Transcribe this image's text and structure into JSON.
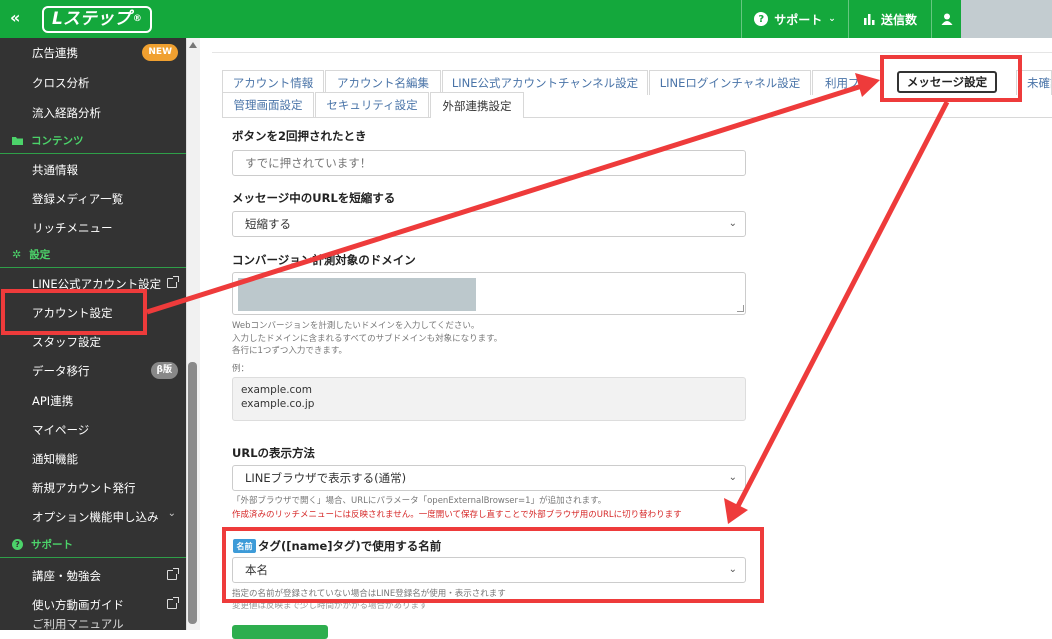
{
  "header": {
    "collapse_label": "«",
    "logo_text": "Lステップ",
    "logo_mark": "®",
    "support_label": "サポート",
    "sent_label": "送信数"
  },
  "sidebar": {
    "items": [
      {
        "label": "広告連携",
        "badge": "NEW"
      },
      {
        "label": "クロス分析"
      },
      {
        "label": "流入経路分析"
      },
      {
        "section": "コンテンツ"
      },
      {
        "label": "共通情報"
      },
      {
        "label": "登録メディア一覧"
      },
      {
        "label": "リッチメニュー"
      },
      {
        "section": "設定"
      },
      {
        "label": "LINE公式アカウント設定"
      },
      {
        "label": "アカウント設定"
      },
      {
        "label": "スタッフ設定"
      },
      {
        "label": "データ移行",
        "badge": "β版"
      },
      {
        "label": "API連携"
      },
      {
        "label": "マイページ"
      },
      {
        "label": "通知機能"
      },
      {
        "label": "新規アカウント発行"
      },
      {
        "label": "オプション機能申し込み"
      },
      {
        "section": "サポート"
      },
      {
        "label": "講座・勉強会"
      },
      {
        "label": "使い方動画ガイド"
      },
      {
        "label": "ご利用マニュアル"
      }
    ]
  },
  "tabs": [
    "アカウント情報",
    "アカウント名編集",
    "LINE公式アカウントチャンネル設定",
    "LINEログインチャネル設定",
    "利用プ",
    "メッセージ設定",
    "未確認ア",
    "管理画面設定",
    "セキュリティ設定",
    "外部連携設定"
  ],
  "form": {
    "double_press_label": "ボタンを2回押されたとき",
    "double_press_placeholder": "すでに押されています！",
    "url_shorten_label": "メッセージ中のURLを短縮する",
    "url_shorten_value": "短縮する",
    "conversion_label": "コンバージョン計測対象のドメイン",
    "conversion_help": [
      "Webコンバージョンを計測したいドメインを入力してください。",
      "入力したドメインに含まれるすべてのサブドメインも対象になります。",
      "各行に1つずつ入力できます。"
    ],
    "example_label": "例：",
    "example_lines": [
      "example.com",
      "example.co.jp"
    ],
    "url_display_label": "URLの表示方法",
    "url_display_value": "LINEブラウザで表示する(通常)",
    "url_display_help": "「外部ブラウザで開く」場合、URLにパラメータ「openExternalBrowser=1」が追加されます。",
    "url_display_warning": "作成済みのリッチメニューには反映されません。一度開いて保存し直すことで外部ブラウザ用のURLに切り替わります",
    "name_tag_badge": "名前",
    "name_tag_label": "タグ([name]タグ)で使用する名前",
    "name_tag_value": "本名",
    "name_tag_help": "指定の名前が登録されていない場合はLINE登録名が使用・表示されます",
    "name_tag_help2": "変更値は反映まで少し時間がかかる場合があります"
  },
  "colors": {
    "brand_green": "#14a83c",
    "sidebar_bg": "#333333",
    "highlight_red": "#ee3b3b",
    "tab_link": "#4a74a8",
    "warning_red": "#d62828"
  }
}
